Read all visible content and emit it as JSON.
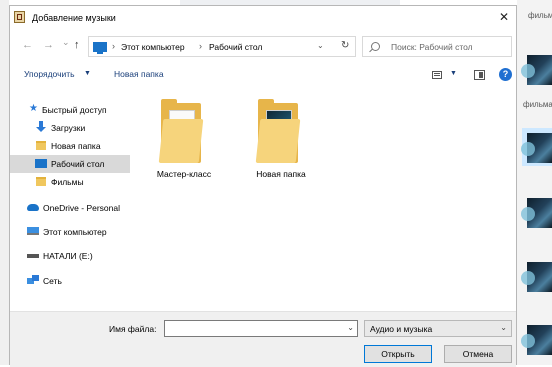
{
  "dialog": {
    "title": "Добавление музыки",
    "close_glyph": "✕"
  },
  "nav": {
    "back_glyph": "←",
    "forward_glyph": "→",
    "recent_glyph": "⌄",
    "up_glyph": "↑",
    "breadcrumb": [
      "Этот компьютер",
      "Рабочий стол"
    ],
    "sep_glyph": "›",
    "dropdown_glyph": "⌄",
    "refresh_glyph": "↻"
  },
  "search": {
    "placeholder": "Поиск: Рабочий стол"
  },
  "toolbar": {
    "organize_label": "Упорядочить",
    "organize_caret": "▼",
    "new_folder_label": "Новая папка",
    "view_caret": "▼",
    "help_glyph": "?"
  },
  "sidebar": {
    "items": [
      {
        "label": "Быстрый доступ",
        "icon": "star-icon"
      },
      {
        "label": "Загрузки",
        "icon": "download-icon"
      },
      {
        "label": "Новая папка",
        "icon": "folder-icon"
      },
      {
        "label": "Рабочий стол",
        "icon": "desktop-icon",
        "selected": true
      },
      {
        "label": "Фильмы",
        "icon": "folder-icon"
      },
      {
        "label": "OneDrive - Personal",
        "icon": "cloud-icon"
      },
      {
        "label": "Этот компьютер",
        "icon": "computer-icon"
      },
      {
        "label": "НАТАЛИ (E:)",
        "icon": "drive-icon"
      },
      {
        "label": "Сеть",
        "icon": "network-icon"
      }
    ]
  },
  "files": [
    {
      "name": "Мастер-класс",
      "icon": "folder-icon"
    },
    {
      "name": "Новая папка",
      "icon": "folder-icon"
    }
  ],
  "bottom": {
    "filename_label": "Имя файла:",
    "filename_value": "",
    "filetype_value": "Аудио и музыка",
    "open_label": "Открыть",
    "cancel_label": "Отмена"
  },
  "background": {
    "label_top": "фильм",
    "label_mid": "фильма"
  }
}
